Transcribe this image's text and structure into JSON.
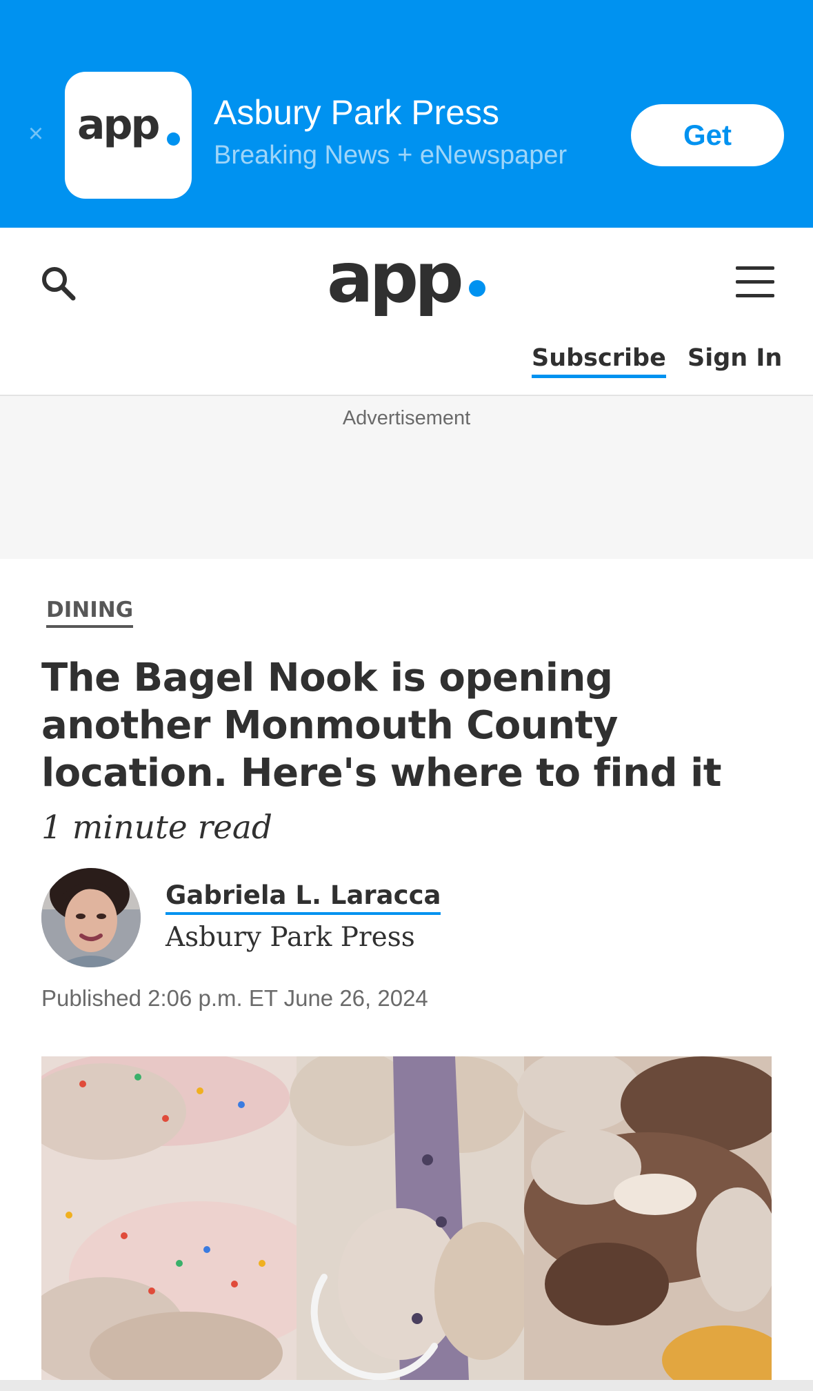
{
  "app_banner": {
    "close_glyph": "×",
    "icon_text": "app",
    "title": "Asbury Park Press",
    "subtitle": "Breaking News + eNewspaper",
    "get_label": "Get",
    "accent_color": "#0092f0"
  },
  "header": {
    "logo_text": "app",
    "subscribe_label": "Subscribe",
    "signin_label": "Sign In"
  },
  "ad": {
    "label": "Advertisement"
  },
  "article": {
    "section": "DINING",
    "headline": "The Bagel Nook is opening another Monmouth County location. Here's where to find it",
    "read_time": "1 minute read",
    "author_name": "Gabriela L. Laracca",
    "author_org": "Asbury Park Press",
    "published": "Published 2:06 p.m. ET June 26, 2024"
  }
}
